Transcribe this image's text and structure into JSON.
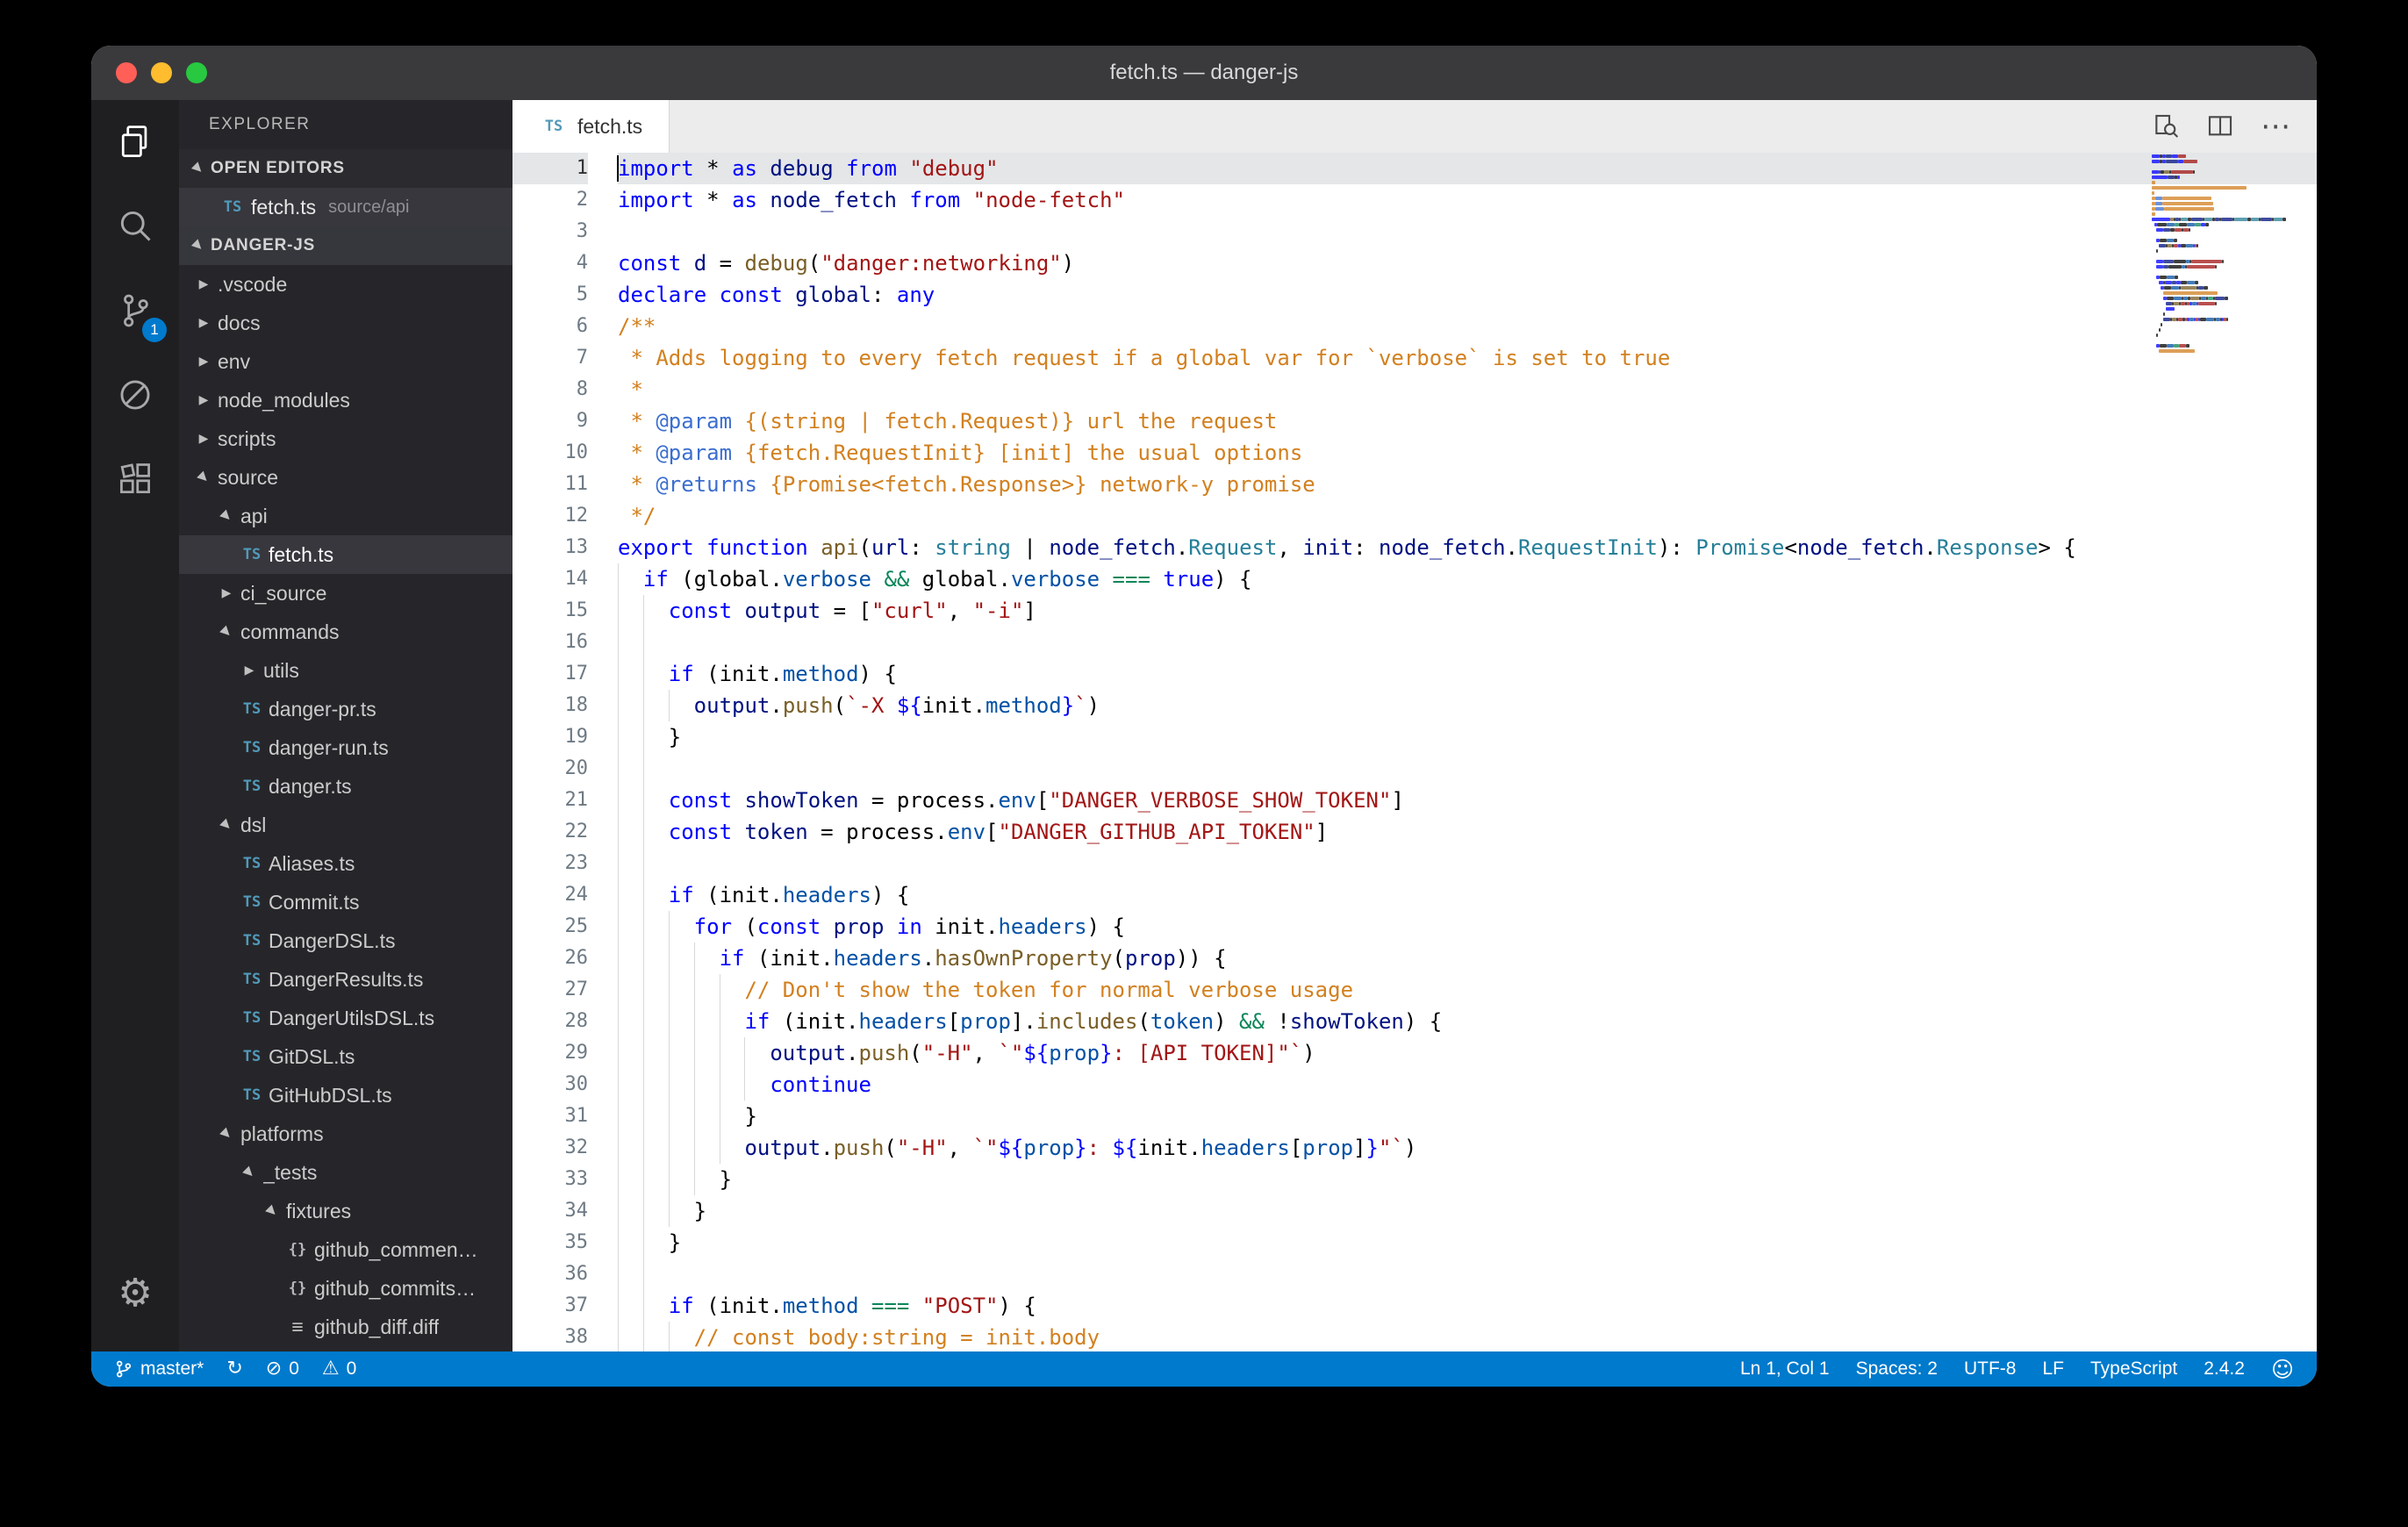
{
  "window": {
    "title": "fetch.ts — danger-js"
  },
  "colors": {
    "accent": "#007acc",
    "titlebar": "#3a3a3c",
    "sidebar_bg": "#26262a",
    "editor_bg": "#ffffff",
    "selection_row": "#37373d",
    "current_line": "#e4e6e8",
    "ts_icon": "#519aba"
  },
  "icons": {
    "ts": "TS",
    "json": "{}",
    "diff": "≡",
    "twisty": "▶",
    "gear": "⚙",
    "sync": "↻",
    "error": "⊘",
    "warning": "⚠",
    "smiley": "☺",
    "more": "⋯"
  },
  "activity_bar": {
    "scm_badge": "1"
  },
  "sidebar": {
    "title": "EXPLORER",
    "open_editors": {
      "label": "OPEN EDITORS",
      "items": [
        {
          "icon": "ts",
          "label": "fetch.ts",
          "detail": "source/api"
        }
      ]
    },
    "project": {
      "label": "DANGER-JS",
      "tree": [
        {
          "type": "folder",
          "name": ".vscode",
          "depth": 0,
          "expanded": false
        },
        {
          "type": "folder",
          "name": "docs",
          "depth": 0,
          "expanded": false
        },
        {
          "type": "folder",
          "name": "env",
          "depth": 0,
          "expanded": false
        },
        {
          "type": "folder",
          "name": "node_modules",
          "depth": 0,
          "expanded": false
        },
        {
          "type": "folder",
          "name": "scripts",
          "depth": 0,
          "expanded": false
        },
        {
          "type": "folder",
          "name": "source",
          "depth": 0,
          "expanded": true
        },
        {
          "type": "folder",
          "name": "api",
          "depth": 1,
          "expanded": true
        },
        {
          "type": "file",
          "icon": "ts",
          "name": "fetch.ts",
          "depth": 2,
          "selected": true
        },
        {
          "type": "folder",
          "name": "ci_source",
          "depth": 1,
          "expanded": false
        },
        {
          "type": "folder",
          "name": "commands",
          "depth": 1,
          "expanded": true
        },
        {
          "type": "folder",
          "name": "utils",
          "depth": 2,
          "expanded": false
        },
        {
          "type": "file",
          "icon": "ts",
          "name": "danger-pr.ts",
          "depth": 2
        },
        {
          "type": "file",
          "icon": "ts",
          "name": "danger-run.ts",
          "depth": 2
        },
        {
          "type": "file",
          "icon": "ts",
          "name": "danger.ts",
          "depth": 2
        },
        {
          "type": "folder",
          "name": "dsl",
          "depth": 1,
          "expanded": true
        },
        {
          "type": "file",
          "icon": "ts",
          "name": "Aliases.ts",
          "depth": 2
        },
        {
          "type": "file",
          "icon": "ts",
          "name": "Commit.ts",
          "depth": 2
        },
        {
          "type": "file",
          "icon": "ts",
          "name": "DangerDSL.ts",
          "depth": 2
        },
        {
          "type": "file",
          "icon": "ts",
          "name": "DangerResults.ts",
          "depth": 2
        },
        {
          "type": "file",
          "icon": "ts",
          "name": "DangerUtilsDSL.ts",
          "depth": 2
        },
        {
          "type": "file",
          "icon": "ts",
          "name": "GitDSL.ts",
          "depth": 2
        },
        {
          "type": "file",
          "icon": "ts",
          "name": "GitHubDSL.ts",
          "depth": 2
        },
        {
          "type": "folder",
          "name": "platforms",
          "depth": 1,
          "expanded": true
        },
        {
          "type": "folder",
          "name": "_tests",
          "depth": 2,
          "expanded": true
        },
        {
          "type": "folder",
          "name": "fixtures",
          "depth": 3,
          "expanded": true
        },
        {
          "type": "file",
          "icon": "json",
          "name": "github_commen…",
          "depth": 4
        },
        {
          "type": "file",
          "icon": "json",
          "name": "github_commits…",
          "depth": 4
        },
        {
          "type": "file",
          "icon": "diff",
          "name": "github_diff.diff",
          "depth": 4
        }
      ]
    }
  },
  "editor": {
    "tab": {
      "label": "fetch.ts"
    },
    "token_colors": {
      "k": "#0000ff",
      "s": "#a31515",
      "c": "#d2801f",
      "g": "#3b6ed0",
      "f": "#795e26",
      "v": "#001080",
      "t": "#267f99",
      "p": "#0451a5",
      "o": "#098658",
      "d": "#000000"
    },
    "lines": [
      {
        "n": 1,
        "ind": 0,
        "current": true,
        "t": [
          [
            "k",
            "import "
          ],
          [
            "d",
            "* "
          ],
          [
            "k",
            "as "
          ],
          [
            "v",
            "debug "
          ],
          [
            "k",
            "from "
          ],
          [
            "s",
            "\"debug\""
          ]
        ]
      },
      {
        "n": 2,
        "ind": 0,
        "t": [
          [
            "k",
            "import "
          ],
          [
            "d",
            "* "
          ],
          [
            "k",
            "as "
          ],
          [
            "v",
            "node_fetch "
          ],
          [
            "k",
            "from "
          ],
          [
            "s",
            "\"node-fetch\""
          ]
        ]
      },
      {
        "n": 3,
        "ind": 0,
        "t": []
      },
      {
        "n": 4,
        "ind": 0,
        "t": [
          [
            "k",
            "const "
          ],
          [
            "v",
            "d"
          ],
          [
            "d",
            " = "
          ],
          [
            "f",
            "debug"
          ],
          [
            "d",
            "("
          ],
          [
            "s",
            "\"danger:networking\""
          ],
          [
            "d",
            ")"
          ]
        ]
      },
      {
        "n": 5,
        "ind": 0,
        "t": [
          [
            "k",
            "declare const "
          ],
          [
            "v",
            "global"
          ],
          [
            "d",
            ": "
          ],
          [
            "k",
            "any"
          ]
        ]
      },
      {
        "n": 6,
        "ind": 0,
        "t": [
          [
            "c",
            "/**"
          ]
        ]
      },
      {
        "n": 7,
        "ind": 0,
        "t": [
          [
            "c",
            " * Adds logging to every fetch request if a global var for `verbose` is set to true"
          ]
        ]
      },
      {
        "n": 8,
        "ind": 0,
        "t": [
          [
            "c",
            " *"
          ]
        ]
      },
      {
        "n": 9,
        "ind": 0,
        "t": [
          [
            "c",
            " * "
          ],
          [
            "g",
            "@param"
          ],
          [
            "c",
            " {(string | fetch.Request)} url the request"
          ]
        ]
      },
      {
        "n": 10,
        "ind": 0,
        "t": [
          [
            "c",
            " * "
          ],
          [
            "g",
            "@param"
          ],
          [
            "c",
            " {fetch.RequestInit} [init] the usual options"
          ]
        ]
      },
      {
        "n": 11,
        "ind": 0,
        "t": [
          [
            "c",
            " * "
          ],
          [
            "g",
            "@returns"
          ],
          [
            "c",
            " {Promise<fetch.Response>} network-y promise"
          ]
        ]
      },
      {
        "n": 12,
        "ind": 0,
        "t": [
          [
            "c",
            " */"
          ]
        ]
      },
      {
        "n": 13,
        "ind": 0,
        "t": [
          [
            "k",
            "export function "
          ],
          [
            "f",
            "api"
          ],
          [
            "d",
            "("
          ],
          [
            "v",
            "url"
          ],
          [
            "d",
            ": "
          ],
          [
            "t",
            "string"
          ],
          [
            "d",
            " | "
          ],
          [
            "v",
            "node_fetch"
          ],
          [
            "d",
            "."
          ],
          [
            "t",
            "Request"
          ],
          [
            "d",
            ", "
          ],
          [
            "v",
            "init"
          ],
          [
            "d",
            ": "
          ],
          [
            "v",
            "node_fetch"
          ],
          [
            "d",
            "."
          ],
          [
            "t",
            "RequestInit"
          ],
          [
            "d",
            "): "
          ],
          [
            "t",
            "Promise"
          ],
          [
            "d",
            "<"
          ],
          [
            "v",
            "node_fetch"
          ],
          [
            "d",
            "."
          ],
          [
            "t",
            "Response"
          ],
          [
            "d",
            "> {"
          ]
        ]
      },
      {
        "n": 14,
        "ind": 1,
        "t": [
          [
            "k",
            "if "
          ],
          [
            "d",
            "(global."
          ],
          [
            "p",
            "verbose"
          ],
          [
            "o",
            " && "
          ],
          [
            "d",
            "global."
          ],
          [
            "p",
            "verbose"
          ],
          [
            "o",
            " === "
          ],
          [
            "k",
            "true"
          ],
          [
            "d",
            ") {"
          ]
        ]
      },
      {
        "n": 15,
        "ind": 2,
        "t": [
          [
            "k",
            "const "
          ],
          [
            "v",
            "output"
          ],
          [
            "d",
            " = ["
          ],
          [
            "s",
            "\"curl\""
          ],
          [
            "d",
            ", "
          ],
          [
            "s",
            "\"-i\""
          ],
          [
            "d",
            "]"
          ]
        ]
      },
      {
        "n": 16,
        "ind": 2,
        "t": []
      },
      {
        "n": 17,
        "ind": 2,
        "t": [
          [
            "k",
            "if "
          ],
          [
            "d",
            "(init."
          ],
          [
            "p",
            "method"
          ],
          [
            "d",
            ") {"
          ]
        ]
      },
      {
        "n": 18,
        "ind": 3,
        "t": [
          [
            "v",
            "output"
          ],
          [
            "d",
            "."
          ],
          [
            "f",
            "push"
          ],
          [
            "d",
            "("
          ],
          [
            "s",
            "`-X "
          ],
          [
            "k",
            "${"
          ],
          [
            "d",
            "init."
          ],
          [
            "p",
            "method"
          ],
          [
            "k",
            "}"
          ],
          [
            "s",
            "`"
          ],
          [
            "d",
            ")"
          ]
        ]
      },
      {
        "n": 19,
        "ind": 2,
        "t": [
          [
            "d",
            "}"
          ]
        ]
      },
      {
        "n": 20,
        "ind": 2,
        "t": []
      },
      {
        "n": 21,
        "ind": 2,
        "t": [
          [
            "k",
            "const "
          ],
          [
            "v",
            "showToken"
          ],
          [
            "d",
            " = process."
          ],
          [
            "p",
            "env"
          ],
          [
            "d",
            "["
          ],
          [
            "s",
            "\"DANGER_VERBOSE_SHOW_TOKEN\""
          ],
          [
            "d",
            "]"
          ]
        ]
      },
      {
        "n": 22,
        "ind": 2,
        "t": [
          [
            "k",
            "const "
          ],
          [
            "v",
            "token"
          ],
          [
            "d",
            " = process."
          ],
          [
            "p",
            "env"
          ],
          [
            "d",
            "["
          ],
          [
            "s",
            "\"DANGER_GITHUB_API_TOKEN\""
          ],
          [
            "d",
            "]"
          ]
        ]
      },
      {
        "n": 23,
        "ind": 2,
        "t": []
      },
      {
        "n": 24,
        "ind": 2,
        "t": [
          [
            "k",
            "if "
          ],
          [
            "d",
            "(init."
          ],
          [
            "p",
            "headers"
          ],
          [
            "d",
            ") {"
          ]
        ]
      },
      {
        "n": 25,
        "ind": 3,
        "t": [
          [
            "k",
            "for "
          ],
          [
            "d",
            "("
          ],
          [
            "k",
            "const "
          ],
          [
            "v",
            "prop"
          ],
          [
            "k",
            " in "
          ],
          [
            "d",
            "init."
          ],
          [
            "p",
            "headers"
          ],
          [
            "d",
            ") {"
          ]
        ]
      },
      {
        "n": 26,
        "ind": 4,
        "t": [
          [
            "k",
            "if "
          ],
          [
            "d",
            "(init."
          ],
          [
            "p",
            "headers"
          ],
          [
            "d",
            "."
          ],
          [
            "f",
            "hasOwnProperty"
          ],
          [
            "d",
            "("
          ],
          [
            "v",
            "prop"
          ],
          [
            "d",
            ")) {"
          ]
        ]
      },
      {
        "n": 27,
        "ind": 5,
        "t": [
          [
            "c",
            "// Don't show the token for normal verbose usage"
          ]
        ]
      },
      {
        "n": 28,
        "ind": 5,
        "t": [
          [
            "k",
            "if "
          ],
          [
            "d",
            "(init."
          ],
          [
            "p",
            "headers"
          ],
          [
            "d",
            "["
          ],
          [
            "p",
            "prop"
          ],
          [
            "d",
            "]."
          ],
          [
            "f",
            "includes"
          ],
          [
            "d",
            "("
          ],
          [
            "p",
            "token"
          ],
          [
            "d",
            ")"
          ],
          [
            "o",
            " && "
          ],
          [
            "d",
            "!"
          ],
          [
            "v",
            "showToken"
          ],
          [
            "d",
            ") {"
          ]
        ]
      },
      {
        "n": 29,
        "ind": 6,
        "t": [
          [
            "v",
            "output"
          ],
          [
            "d",
            "."
          ],
          [
            "f",
            "push"
          ],
          [
            "d",
            "("
          ],
          [
            "s",
            "\"-H\""
          ],
          [
            "d",
            ", "
          ],
          [
            "s",
            "`\""
          ],
          [
            "k",
            "${"
          ],
          [
            "p",
            "prop"
          ],
          [
            "k",
            "}"
          ],
          [
            "s",
            ": [API TOKEN]\"`"
          ],
          [
            "d",
            ")"
          ]
        ]
      },
      {
        "n": 30,
        "ind": 6,
        "t": [
          [
            "k",
            "continue"
          ]
        ]
      },
      {
        "n": 31,
        "ind": 5,
        "t": [
          [
            "d",
            "}"
          ]
        ]
      },
      {
        "n": 32,
        "ind": 5,
        "t": [
          [
            "v",
            "output"
          ],
          [
            "d",
            "."
          ],
          [
            "f",
            "push"
          ],
          [
            "d",
            "("
          ],
          [
            "s",
            "\"-H\""
          ],
          [
            "d",
            ", "
          ],
          [
            "s",
            "`\""
          ],
          [
            "k",
            "${"
          ],
          [
            "p",
            "prop"
          ],
          [
            "k",
            "}"
          ],
          [
            "s",
            ": "
          ],
          [
            "k",
            "${"
          ],
          [
            "d",
            "init."
          ],
          [
            "p",
            "headers"
          ],
          [
            "d",
            "["
          ],
          [
            "p",
            "prop"
          ],
          [
            "d",
            "]"
          ],
          [
            "k",
            "}"
          ],
          [
            "s",
            "\"`"
          ],
          [
            "d",
            ")"
          ]
        ]
      },
      {
        "n": 33,
        "ind": 4,
        "t": [
          [
            "d",
            "}"
          ]
        ]
      },
      {
        "n": 34,
        "ind": 3,
        "t": [
          [
            "d",
            "}"
          ]
        ]
      },
      {
        "n": 35,
        "ind": 2,
        "t": [
          [
            "d",
            "}"
          ]
        ]
      },
      {
        "n": 36,
        "ind": 2,
        "t": []
      },
      {
        "n": 37,
        "ind": 2,
        "t": [
          [
            "k",
            "if "
          ],
          [
            "d",
            "(init."
          ],
          [
            "p",
            "method"
          ],
          [
            "o",
            " === "
          ],
          [
            "s",
            "\"POST\""
          ],
          [
            "d",
            ") {"
          ]
        ]
      },
      {
        "n": 38,
        "ind": 3,
        "t": [
          [
            "c",
            "// const body:string = init.body"
          ]
        ]
      }
    ]
  },
  "status_bar": {
    "branch": "master*",
    "errors": "0",
    "warnings": "0",
    "right_items": [
      {
        "name": "cursor-position",
        "label": "Ln 1, Col 1"
      },
      {
        "name": "indentation",
        "label": "Spaces: 2"
      },
      {
        "name": "encoding",
        "label": "UTF-8"
      },
      {
        "name": "eol",
        "label": "LF"
      },
      {
        "name": "language-mode",
        "label": "TypeScript"
      },
      {
        "name": "extension-version",
        "label": "2.4.2"
      }
    ]
  }
}
